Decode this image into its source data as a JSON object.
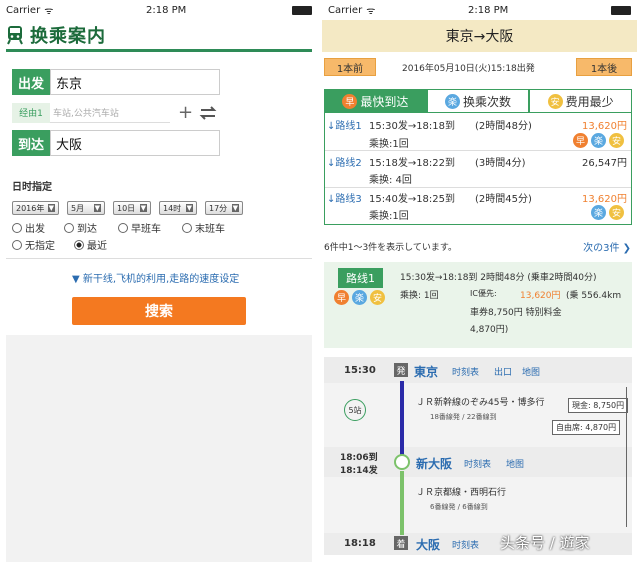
{
  "colors": {
    "green": "#3a9e5f",
    "orange": "#f47920",
    "blue": "#2b6cb0"
  },
  "left": {
    "status": {
      "carrier": "Carrier",
      "time": "2:18 PM"
    },
    "title": "换乘案内",
    "from_tag": "出发",
    "from_value": "东京",
    "via_tag": "经由1",
    "via_placeholder": "车站,公共汽车站",
    "to_tag": "到达",
    "to_value": "大阪",
    "date_label": "日时指定",
    "selects": [
      "2016年",
      "5月",
      "10日",
      "14时",
      "17分"
    ],
    "radios": [
      {
        "label": "出发",
        "on": false
      },
      {
        "label": "到达",
        "on": false
      },
      {
        "label": "早班车",
        "on": false
      },
      {
        "label": "末班车",
        "on": false
      },
      {
        "label": "无指定",
        "on": false
      },
      {
        "label": "最近",
        "on": true
      }
    ],
    "settings_link": "▼ 新干线,飞机的利用,走路的速度设定",
    "search_label": "搜索"
  },
  "right": {
    "status": {
      "carrier": "Carrier",
      "time": "2:18 PM"
    },
    "header": "東京→大阪",
    "prev": "1本前",
    "next": "1本後",
    "date": "2016年05月10日(火)15:18出発",
    "tabs": [
      "最快到达",
      "换乘次数",
      "费用最少"
    ],
    "routes": [
      {
        "name": "↓路线1",
        "time": "15:30发→18:18到",
        "dur": "(2時間48分)",
        "fare": "13,620円",
        "transfer": "乘换:1回"
      },
      {
        "name": "↓路线2",
        "time": "15:18发→18:22到",
        "dur": "(3時間4分)",
        "fare": "26,547円",
        "transfer": "乘换: 4回"
      },
      {
        "name": "↓路线3",
        "time": "15:40发→18:25到",
        "dur": "(2時間45分)",
        "fare": "13,620円",
        "transfer": "乘换:1回"
      }
    ],
    "count_text": "6件中1～3件を表示しています。",
    "next3": "次の3件 ❯",
    "summary": {
      "tag": "路线1",
      "line1": "15:30发→18:18到  2時間48分 (乗車2時間40分)",
      "transfer": "乘换: 1回",
      "ic": "IC優先:",
      "fare": "13,620円",
      "dist": "(乗 556.4km",
      "ticket": "車券8,750円  特別料金",
      "total": "4,870円)"
    },
    "timeline": {
      "t1": "15:30",
      "s1": "東京",
      "mark1": "発",
      "train1": "ＪＲ新幹線のぞみ45号・博多行",
      "train1_sub": "18番線発 / 22番線到",
      "stops": "5站",
      "genkin": "現金:   8,750円",
      "jiyuseki": "自由席:  4,870円",
      "t2a": "18:06到",
      "t2b": "18:14发",
      "s2": "新大阪",
      "train2": "ＪＲ京都線・西明石行",
      "train2_sub": "6番線発 / 6番線到",
      "t3": "18:18",
      "s3": "大阪",
      "mark3": "着",
      "links": [
        "时刻表",
        "出口",
        "地图"
      ]
    },
    "watermark": "头条号 / 遊家"
  }
}
